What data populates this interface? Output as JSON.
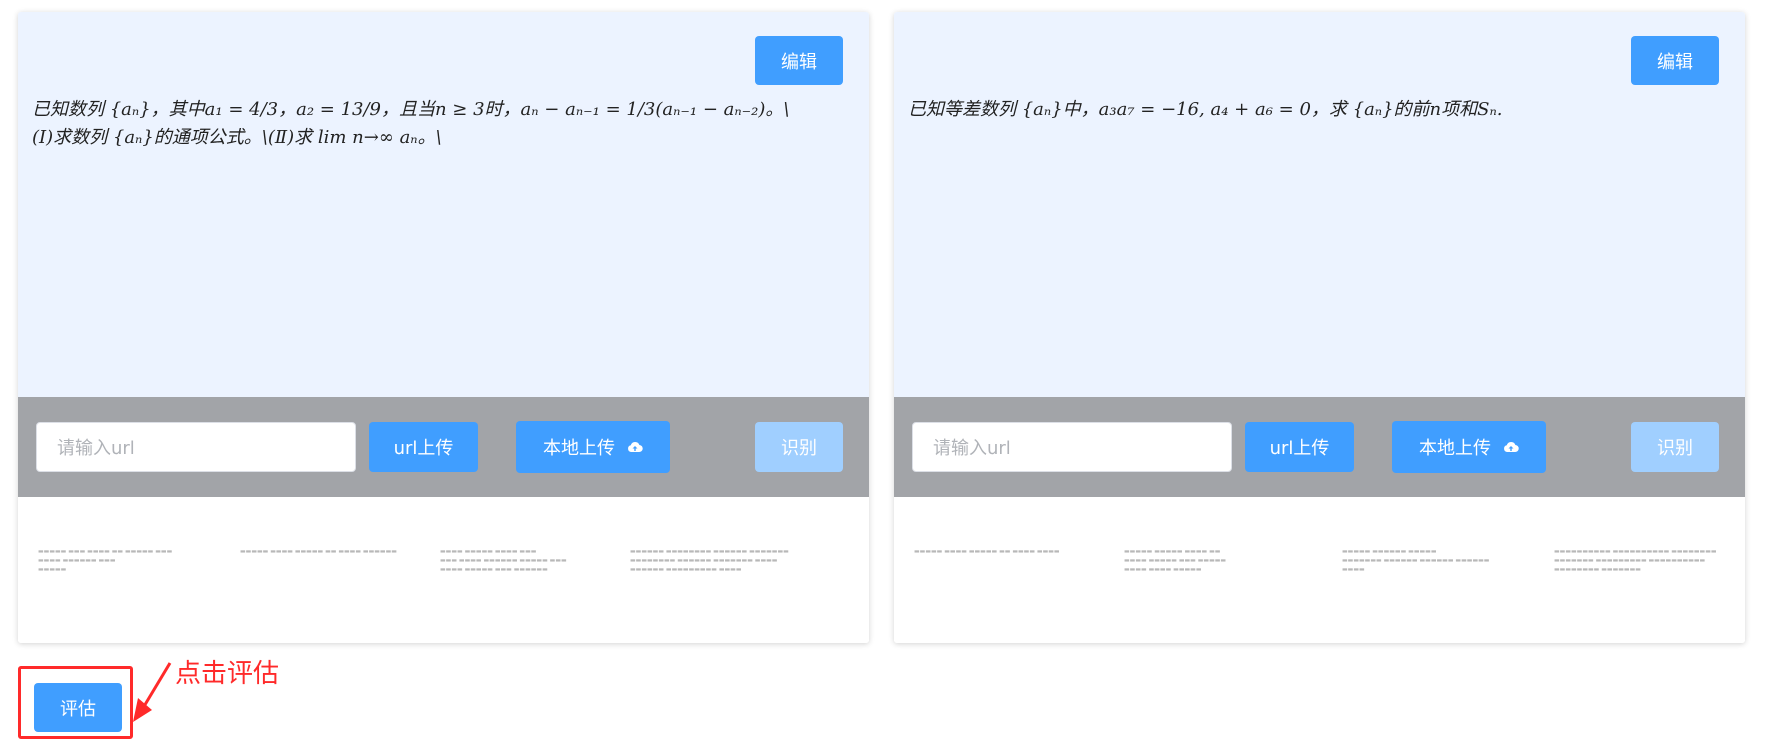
{
  "panels": [
    {
      "edit_label": "编辑",
      "problem_lines": [
        "已知数列 {aₙ}，其中a₁ = 4/3，a₂ = 13/9，且当n ≥ 3时，aₙ − aₙ₋₁ = 1/3(aₙ₋₁ − aₙ₋₂)。\\",
        "(Ⅰ)求数列 {aₙ}的通项公式。\\(Ⅱ)求 lim n→∞ aₙ。\\"
      ],
      "url_placeholder": "请输入url",
      "url_upload_label": "url上传",
      "local_upload_label": "本地上传",
      "recognize_label": "识别"
    },
    {
      "edit_label": "编辑",
      "problem_lines": [
        "已知等差数列 {aₙ}中，a₃a₇ = −16, a₄ + a₆ = 0，求 {aₙ}的前n项和Sₙ."
      ],
      "url_placeholder": "请输入url",
      "url_upload_label": "url上传",
      "local_upload_label": "本地上传",
      "recognize_label": "识别"
    }
  ],
  "evaluate_label": "评估",
  "annotation_text": "点击评估",
  "colors": {
    "primary": "#409eff",
    "primary_disabled": "#a0cfff",
    "problem_bg": "#ecf3ff",
    "upload_bar_bg": "#a2a4a8",
    "annotation": "#ff2a2a"
  }
}
